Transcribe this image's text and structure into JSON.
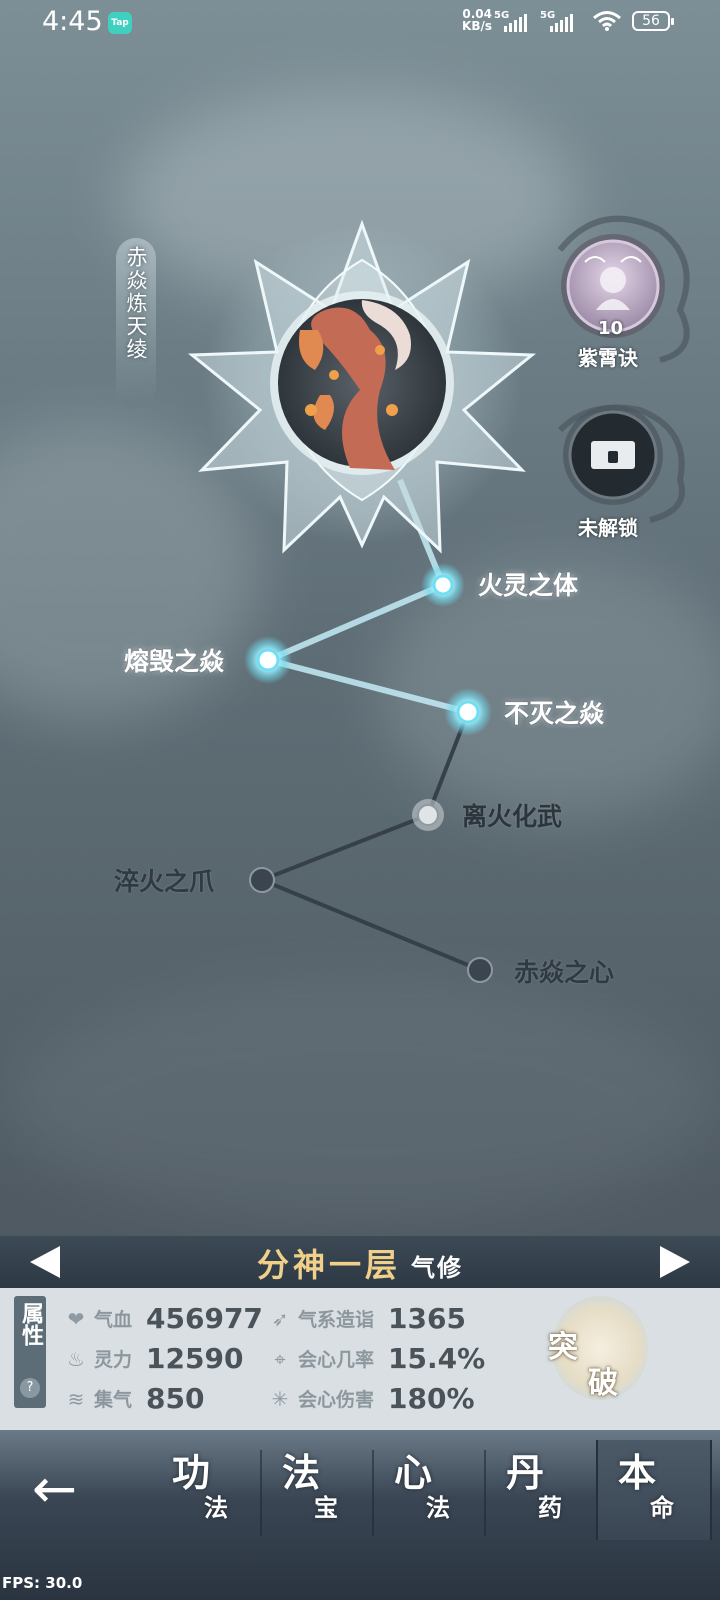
{
  "status_bar": {
    "time": "4:45",
    "app_badge": "Tap",
    "net_speed_value": "0.04",
    "net_speed_unit": "KB/s",
    "signal1": "5G",
    "signal2": "5G",
    "battery": "56"
  },
  "skill_tree": {
    "title": "赤焱炼天绫",
    "nodes": {
      "n1": "火灵之体",
      "n2": "熔毁之焱",
      "n3": "不灭之焱",
      "n4": "离火化武",
      "n5": "淬火之爪",
      "n6": "赤焱之心"
    }
  },
  "side_slots": {
    "slot1_level": "10",
    "slot1_name": "紫霄诀",
    "slot2_name": "未解锁"
  },
  "realm": {
    "name": "分神一层",
    "type": "气修"
  },
  "attributes": {
    "tab_label": "属性",
    "help": "?",
    "stats": {
      "hp_label": "气血",
      "hp_value": "456977",
      "sp_label": "灵力",
      "sp_value": "12590",
      "gather_label": "集气",
      "gather_value": "850",
      "qi_label": "气系造诣",
      "qi_value": "1365",
      "crit_label": "会心几率",
      "crit_value": "15.4%",
      "critdmg_label": "会心伤害",
      "critdmg_value": "180%"
    },
    "breakthrough_1": "突",
    "breakthrough_2": "破"
  },
  "bottom_nav": {
    "tabs": [
      {
        "big": "功",
        "small": "法"
      },
      {
        "big": "法",
        "small": "宝"
      },
      {
        "big": "心",
        "small": "法"
      },
      {
        "big": "丹",
        "small": "药"
      },
      {
        "big": "本",
        "small": "命"
      }
    ]
  },
  "fps": "FPS: 30.0"
}
